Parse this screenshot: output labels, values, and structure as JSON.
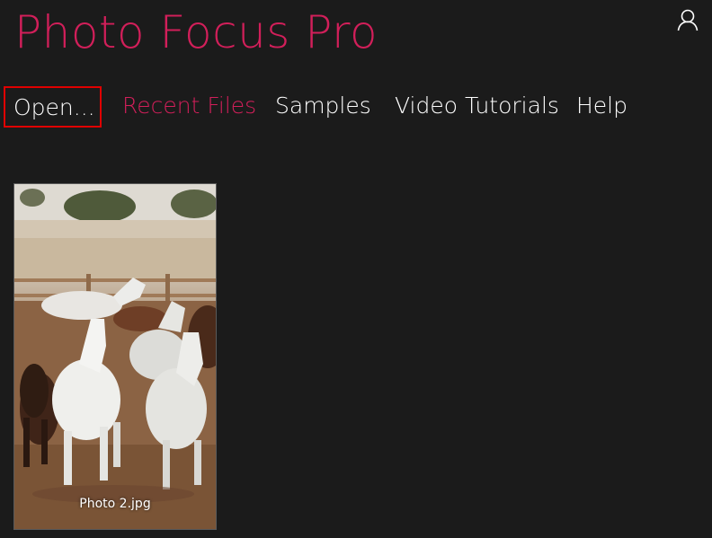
{
  "app": {
    "title": "Photo Focus Pro",
    "accent_color": "#d21f5a",
    "background_color": "#1b1b1b"
  },
  "header": {
    "user_icon": "user-account-icon"
  },
  "nav": {
    "items": [
      {
        "label": "Open...",
        "state": "focused"
      },
      {
        "label": "Recent Files",
        "state": "active"
      },
      {
        "label": "Samples",
        "state": "normal"
      },
      {
        "label": "Video Tutorials",
        "state": "normal"
      },
      {
        "label": "Help",
        "state": "normal"
      }
    ]
  },
  "gallery": {
    "items": [
      {
        "filename": "Photo 2.jpg",
        "subject": "horses running in a dirt paddock"
      }
    ]
  }
}
